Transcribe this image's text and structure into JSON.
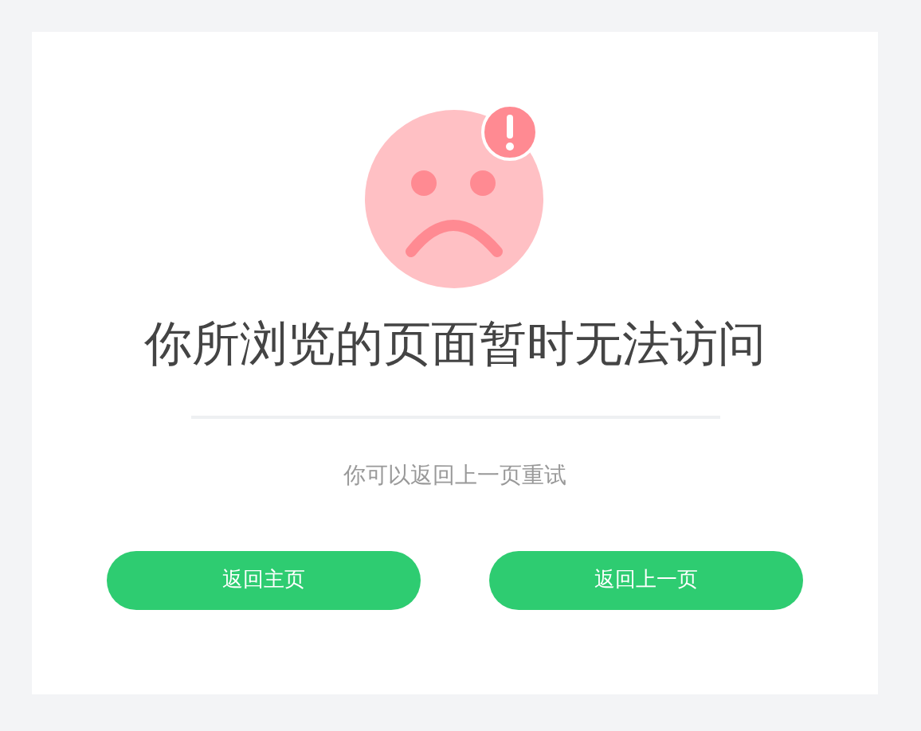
{
  "title": "你所浏览的页面暂时无法访问",
  "subtitle": "你可以返回上一页重试",
  "buttons": [
    {
      "label": "返回主页"
    },
    {
      "label": "返回上一页"
    }
  ]
}
